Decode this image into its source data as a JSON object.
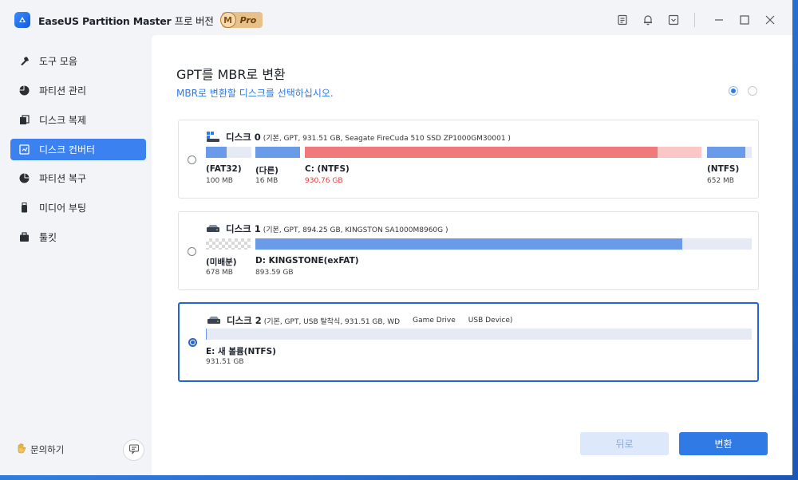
{
  "app": {
    "title": "EaseUS Partition Master",
    "subtitle": "프로 버전",
    "badge_letter": "M",
    "badge_text": "Pro"
  },
  "sidebar": {
    "items": [
      {
        "label": "도구 모음",
        "icon": "wrench-icon"
      },
      {
        "label": "파티션 관리",
        "icon": "pie-chart-icon"
      },
      {
        "label": "디스크 복제",
        "icon": "clone-icon"
      },
      {
        "label": "디스크 컨버터",
        "icon": "disk-convert-icon",
        "active": true
      },
      {
        "label": "파티션 복구",
        "icon": "recovery-icon"
      },
      {
        "label": "미디어 부팅",
        "icon": "usb-boot-icon"
      },
      {
        "label": "툴킷",
        "icon": "toolkit-icon"
      }
    ],
    "help_label": "문의하기"
  },
  "main": {
    "title": "GPT를 MBR로 변환",
    "subtitle": "MBR로 변환할 디스크를 선택하십시오.",
    "back_label": "뒤로",
    "convert_label": "변환"
  },
  "disks": [
    {
      "name": "디스크 0",
      "info": "(기본, GPT, 931.51 GB, Seagate FireCuda 510 SSD ZP1000GM30001 )",
      "selected": false,
      "partitions": [
        {
          "label": "(FAT32)",
          "size": "100 MB",
          "color": "#6a9be8",
          "used_fraction": 0.45
        },
        {
          "label": "(다른)",
          "size": "16 MB",
          "color": "#6a9be8",
          "used_fraction": 1.0
        },
        {
          "label": "C: (NTFS)",
          "size": "930.76 GB",
          "color": "#f07a7a",
          "size_color": "#e43a3a",
          "used_fraction": 0.89
        },
        {
          "label": "(NTFS)",
          "size": "652 MB",
          "color": "#6a9be8",
          "used_fraction": 0.85
        }
      ]
    },
    {
      "name": "디스크 1",
      "info": "(기본, GPT, 894.25 GB, KINGSTON SA1000M8960G )",
      "selected": false,
      "partitions": [
        {
          "label": "(미배분)",
          "size": "678 MB",
          "unallocated": true
        },
        {
          "label": "D: KINGSTONE(exFAT)",
          "size": "893.59 GB",
          "color": "#6a9be8",
          "used_fraction": 0.86
        }
      ]
    },
    {
      "name": "디스크 2",
      "info": "(기본, GPT, USB 탈착식, 931.51 GB, WD",
      "tags": [
        "Game Drive",
        "USB Device)"
      ],
      "selected": true,
      "partitions": [
        {
          "label": "E: 새 볼륨(NTFS)",
          "size": "931.51 GB",
          "color": "#6a9be8",
          "used_fraction": 0.002
        }
      ]
    }
  ]
}
